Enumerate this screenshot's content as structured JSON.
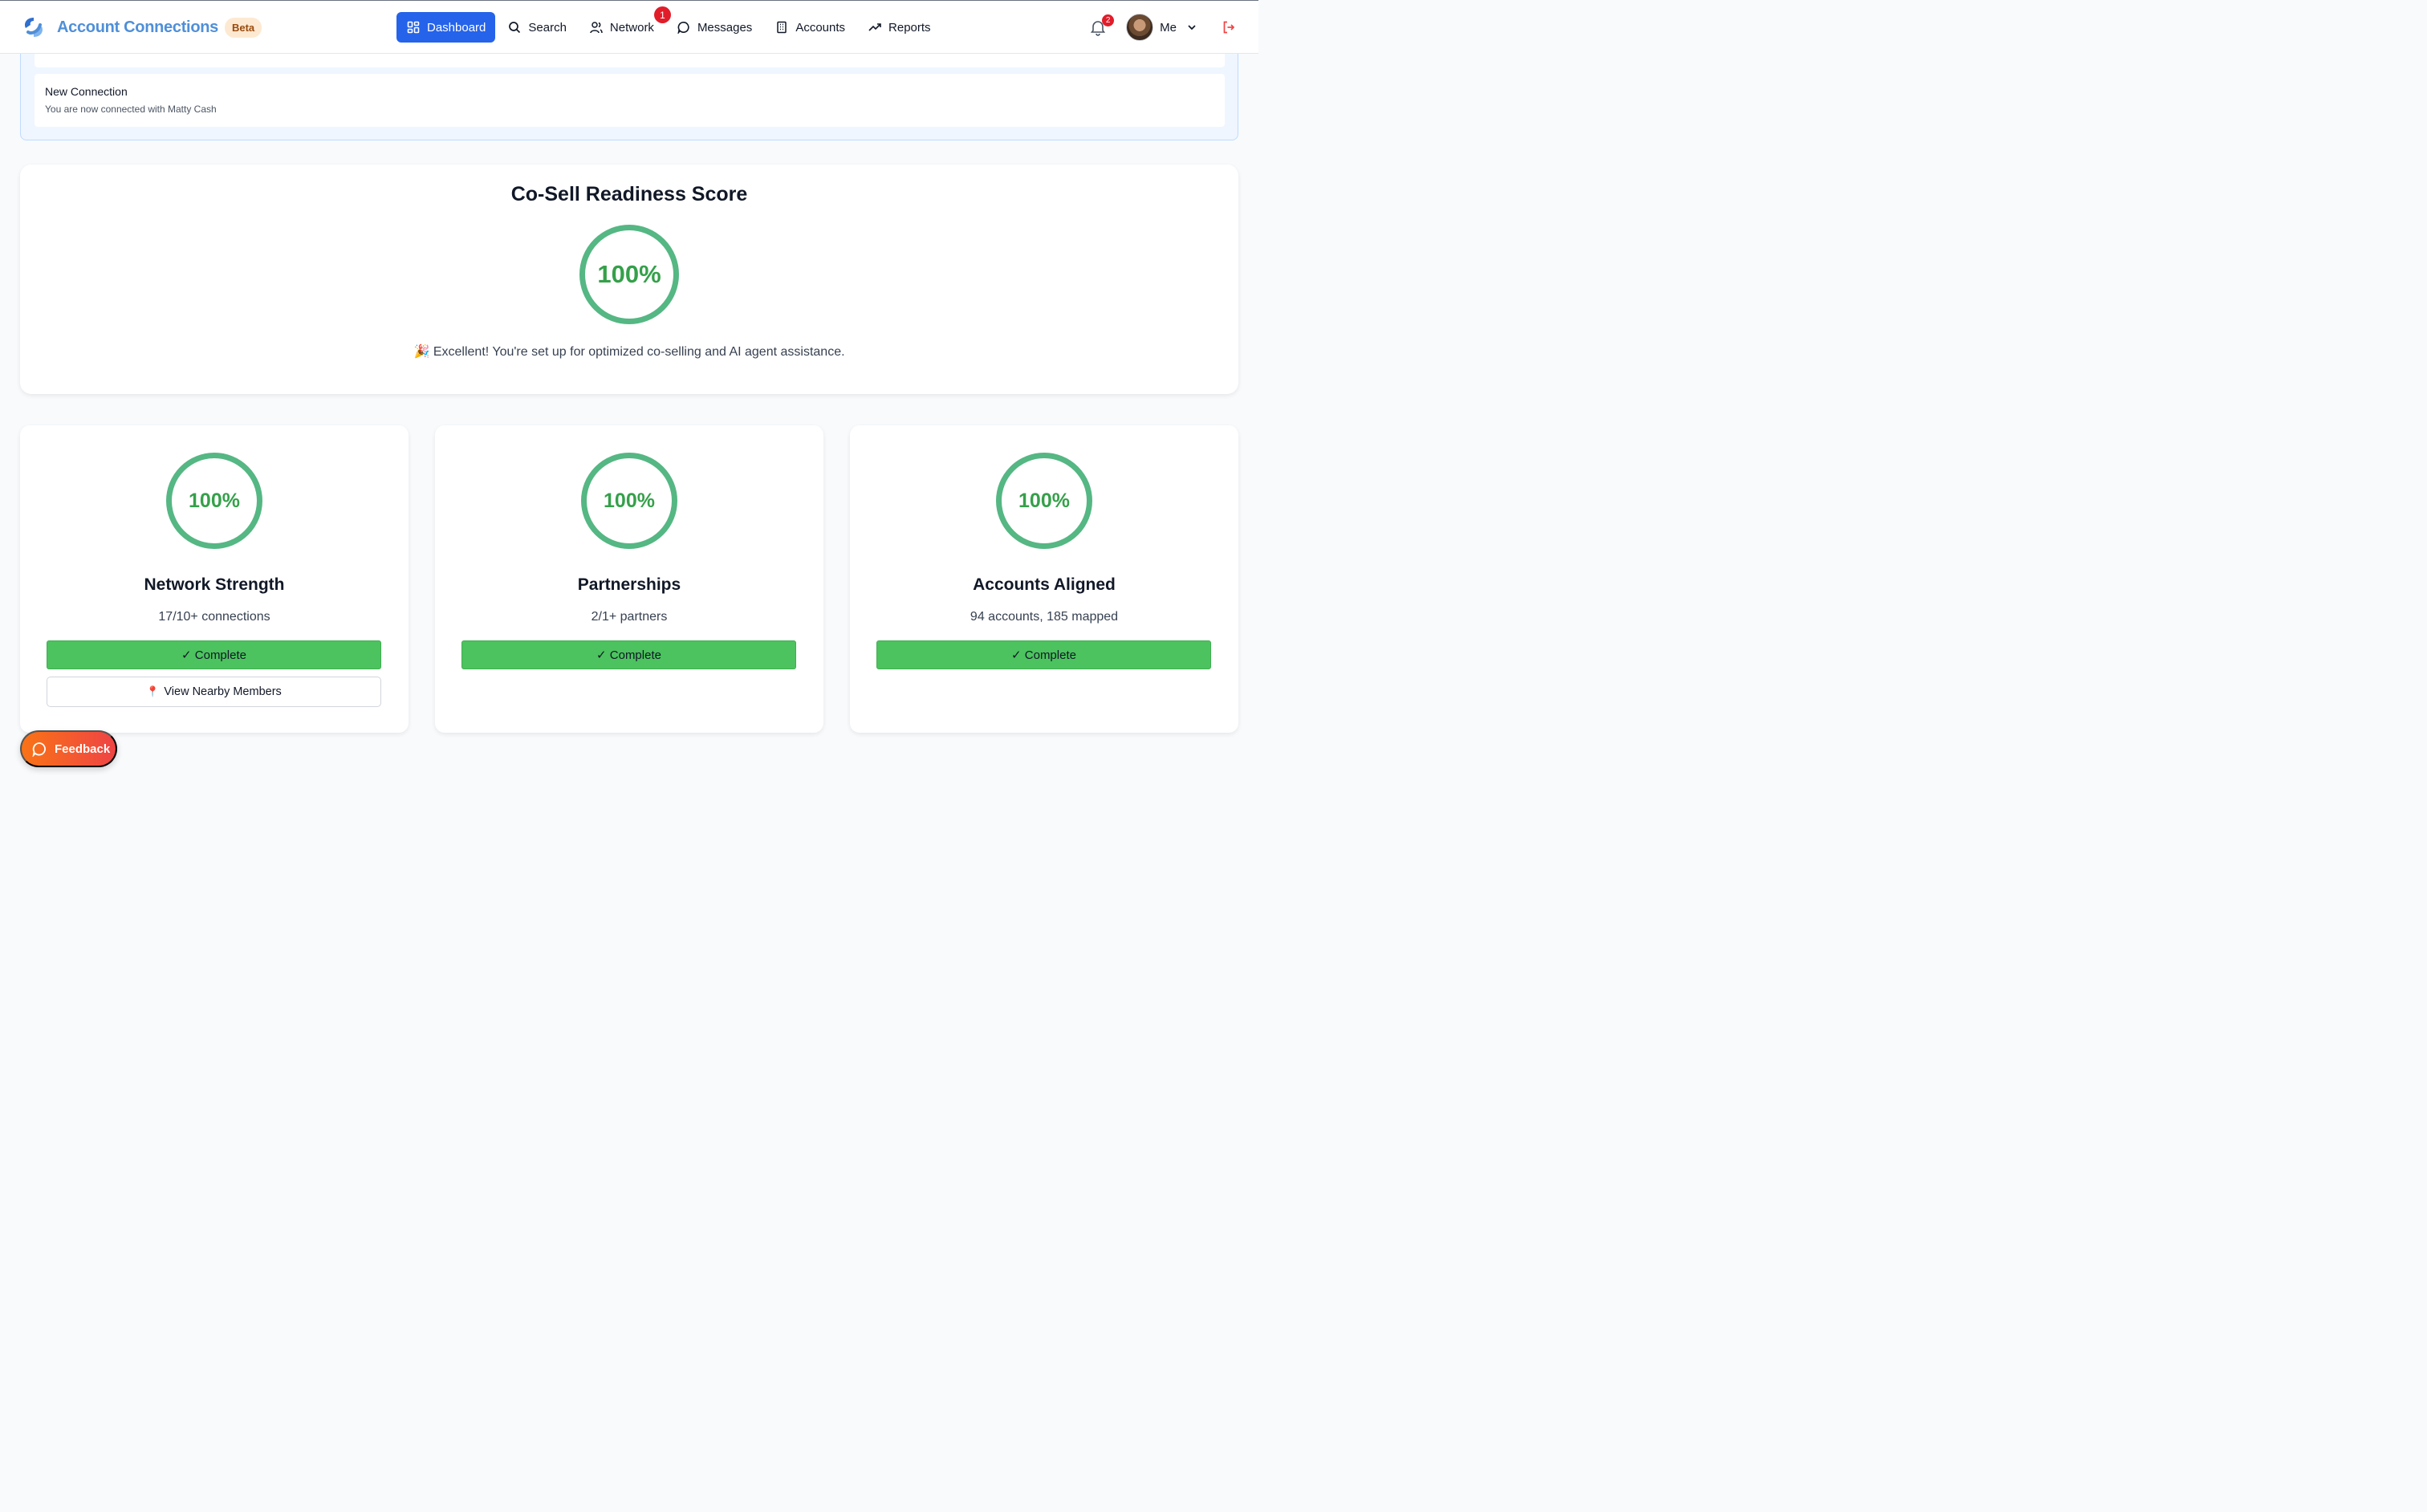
{
  "app": {
    "title": "Account Connections",
    "badge": "Beta"
  },
  "nav": {
    "items": [
      {
        "label": "Dashboard",
        "icon": "grid-icon",
        "active": true
      },
      {
        "label": "Search",
        "icon": "search-icon"
      },
      {
        "label": "Network",
        "icon": "users-icon",
        "badge": "1"
      },
      {
        "label": "Messages",
        "icon": "chat-icon"
      },
      {
        "label": "Accounts",
        "icon": "building-icon"
      },
      {
        "label": "Reports",
        "icon": "trending-up-icon"
      }
    ]
  },
  "user": {
    "notification_count": "2",
    "name": "Me"
  },
  "notifications": [
    {
      "title": "New Connection",
      "description": "You are now connected with Matty Cash"
    }
  ],
  "score": {
    "title": "Co-Sell Readiness Score",
    "value": "100%",
    "message": "🎉 Excellent! You're set up for optimized co-selling and AI agent assistance."
  },
  "metrics": [
    {
      "percent": "100%",
      "title": "Network Strength",
      "subtitle": "17/10+ connections",
      "status": "✓ Complete",
      "extra_button": "View Nearby Members"
    },
    {
      "percent": "100%",
      "title": "Partnerships",
      "subtitle": "2/1+ partners",
      "status": "✓ Complete"
    },
    {
      "percent": "100%",
      "title": "Accounts Aligned",
      "subtitle": "94 accounts, 185 mapped",
      "status": "✓ Complete"
    }
  ],
  "feedback": {
    "label": "Feedback"
  },
  "colors": {
    "primary": "#2563eb",
    "brand_text": "#4f8fd8",
    "success": "#4cc35e",
    "ring": "#55b783",
    "badge": "#e11d2a",
    "feedback_start": "#f97316",
    "feedback_end": "#ef4444"
  }
}
